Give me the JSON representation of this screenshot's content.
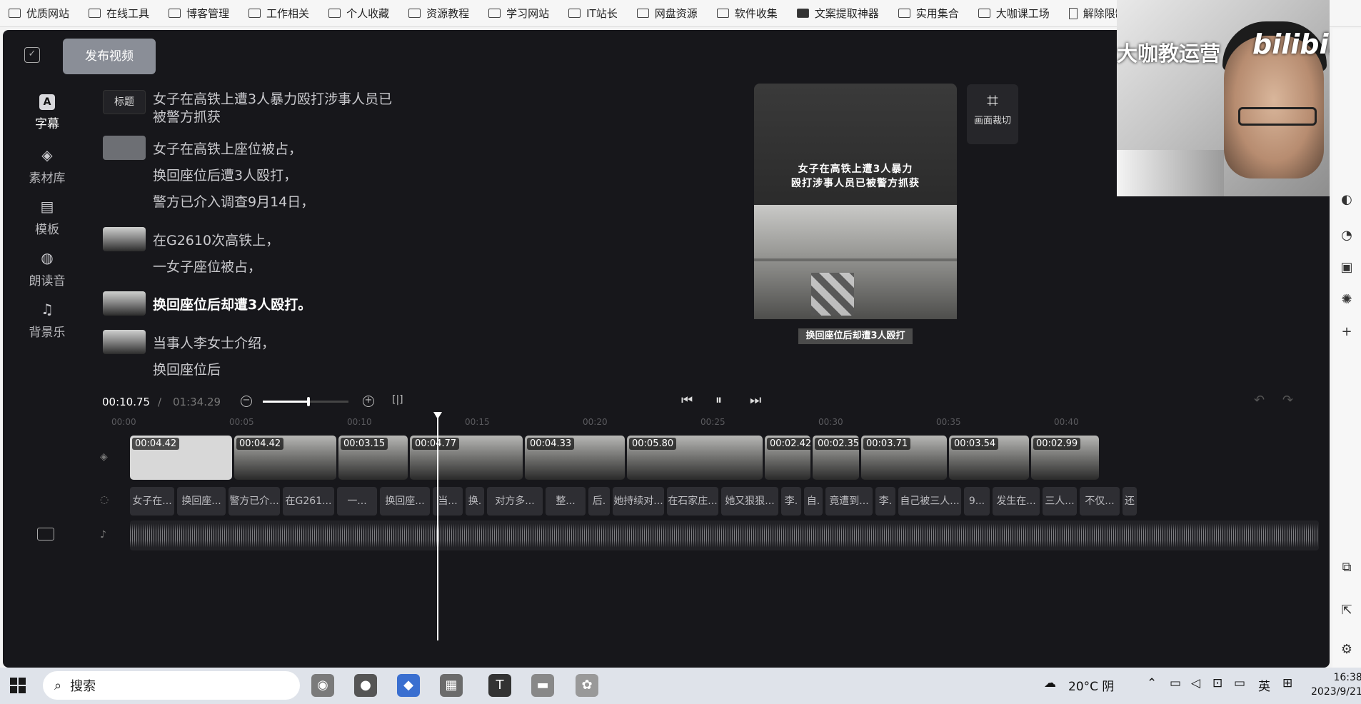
{
  "bookmarks": [
    {
      "label": "优质网站",
      "icon": "folder-icon"
    },
    {
      "label": "在线工具",
      "icon": "folder-icon"
    },
    {
      "label": "博客管理",
      "icon": "folder-icon"
    },
    {
      "label": "工作相关",
      "icon": "folder-icon"
    },
    {
      "label": "个人收藏",
      "icon": "folder-icon"
    },
    {
      "label": "资源教程",
      "icon": "folder-icon"
    },
    {
      "label": "学习网站",
      "icon": "folder-icon"
    },
    {
      "label": "IT站长",
      "icon": "folder-icon"
    },
    {
      "label": "网盘资源",
      "icon": "folder-icon"
    },
    {
      "label": "软件收集",
      "icon": "folder-icon"
    },
    {
      "label": "文案提取神器",
      "icon": "app-icon"
    },
    {
      "label": "实用集合",
      "icon": "folder-icon"
    },
    {
      "label": "大咖课工场",
      "icon": "folder-icon"
    },
    {
      "label": "解除限制",
      "icon": "page-icon"
    }
  ],
  "toolbar": {
    "publish_label": "发布视频"
  },
  "sidebar": {
    "items": [
      {
        "label": "字幕",
        "icon": "subtitle-icon",
        "glyph": "A"
      },
      {
        "label": "素材库",
        "icon": "layers-icon",
        "glyph": "◈"
      },
      {
        "label": "模板",
        "icon": "template-icon",
        "glyph": "▤"
      },
      {
        "label": "朗读音",
        "icon": "voice-icon",
        "glyph": "◍"
      },
      {
        "label": "背景乐",
        "icon": "music-icon",
        "glyph": "♫"
      }
    ]
  },
  "script": {
    "title_tag": "标题",
    "title_lines": [
      "女子在高铁上遭3人暴力殴打涉事人员已",
      "被警方抓获"
    ],
    "para1": [
      "女子在高铁上座位被占，",
      "换回座位后遭3人殴打，",
      "警方已介入调查9月14日，"
    ],
    "para2": [
      "在G2610次高铁上，",
      "一女子座位被占，"
    ],
    "para3": [
      "换回座位后却遭3人殴打。"
    ],
    "para4": [
      "当事人李女士介绍，",
      "换回座位后"
    ]
  },
  "preview": {
    "title_line1": "女子在高铁上遭3人暴力",
    "title_line2": "殴打涉事人员已被警方抓获",
    "subtitle": "换回座位后却遭3人殴打",
    "crop_label": "画面裁切"
  },
  "webcam": {
    "overlay_text": "大咖教运营",
    "brand_logo": "bilibili"
  },
  "playback": {
    "current_time": "00:10.75",
    "separator": "/",
    "total_time": "01:34.29",
    "zoom_level": 0.53,
    "fit_label": "[|]"
  },
  "ruler": [
    "00:00",
    "00:05",
    "00:10",
    "00:15",
    "00:20",
    "00:25",
    "00:30",
    "00:35",
    "00:40"
  ],
  "video_clips": [
    "00:04.42",
    "00:04.42",
    "00:03.15",
    "00:04.77",
    "00:04.33",
    "00:05.80",
    "00:02.42",
    "00:02.35",
    "00:03.71",
    "00:03.54",
    "00:02.99"
  ],
  "text_clips": [
    "女子在...",
    "换回座...",
    "警方已介...",
    "在G261...",
    "一...",
    "换回座...",
    "当...",
    "换.",
    "对方多...",
    "整...",
    "后.",
    "她持续对...",
    "在石家庄...",
    "她又狠狠...",
    "李.",
    "自.",
    "竟遭到...",
    "李.",
    "自己被三人...",
    "9...",
    "发生在...",
    "三人...",
    "不仅...",
    "还"
  ],
  "taskbar": {
    "search_label": "搜索",
    "weather": "20°C 阴",
    "ime": "英",
    "time": "16:38",
    "date": "2023/9/21"
  }
}
